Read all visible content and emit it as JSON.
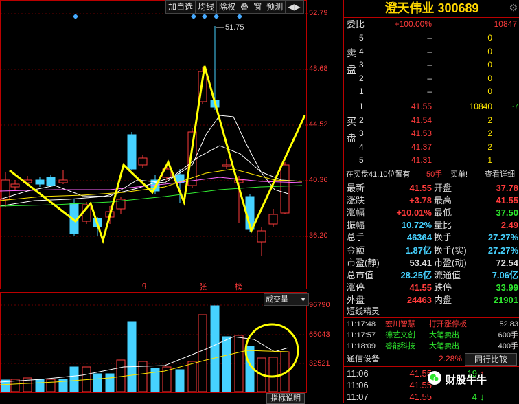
{
  "toolbar": {
    "items": [
      "加自选",
      "均线",
      "除权",
      "叠",
      "窗",
      "预测",
      "◀▶"
    ]
  },
  "chart": {
    "price_axis": [
      "52.79",
      "48.68",
      "44.52",
      "40.36",
      "36.20"
    ],
    "vol_axis": [
      "96790",
      "65043",
      "32521"
    ],
    "annotation": "51.75",
    "markers": {
      "q": "q",
      "zhang": "张",
      "bang": "榜"
    },
    "vol_dropdown": "成交量",
    "indicator_button": "指标说明",
    "colors": {
      "up": "#ff3b3b",
      "down": "#46d2ff",
      "ma_white": "#ffffff",
      "ma_yellow": "#ffe600",
      "ma_magenta": "#ff66ff",
      "ma_green": "#33ee33",
      "zigzag": "#ffff00"
    }
  },
  "quote": {
    "title": "澄天伟业 300689",
    "weibi": {
      "label": "委比",
      "pct": "+100.00%",
      "diff": "10847"
    },
    "sell_label": [
      "卖",
      "盘"
    ],
    "buy_label": [
      "买",
      "盘"
    ],
    "sell": [
      {
        "lvl": "5",
        "price": "–",
        "vol": "0"
      },
      {
        "lvl": "4",
        "price": "–",
        "vol": "0"
      },
      {
        "lvl": "3",
        "price": "–",
        "vol": "0"
      },
      {
        "lvl": "2",
        "price": "–",
        "vol": "0"
      },
      {
        "lvl": "1",
        "price": "–",
        "vol": "0"
      }
    ],
    "buy": [
      {
        "lvl": "1",
        "price": "41.55",
        "vol": "10840",
        "chg": "-7"
      },
      {
        "lvl": "2",
        "price": "41.54",
        "vol": "2",
        "chg": ""
      },
      {
        "lvl": "3",
        "price": "41.53",
        "vol": "2",
        "chg": ""
      },
      {
        "lvl": "4",
        "price": "41.37",
        "vol": "2",
        "chg": ""
      },
      {
        "lvl": "5",
        "price": "41.31",
        "vol": "1",
        "chg": ""
      }
    ],
    "bar": {
      "text": "在买盘41.10位置有",
      "hand": "50手",
      "order": "买单!",
      "detail": "查看详细"
    },
    "stats": [
      {
        "l1": "最新",
        "v1": "41.55",
        "c1": "red",
        "l2": "开盘",
        "v2": "37.78",
        "c2": "red"
      },
      {
        "l1": "涨跌",
        "v1": "+3.78",
        "c1": "red",
        "l2": "最高",
        "v2": "41.55",
        "c2": "red"
      },
      {
        "l1": "涨幅",
        "v1": "+10.01%",
        "c1": "red",
        "l2": "最低",
        "v2": "37.50",
        "c2": "grn"
      },
      {
        "l1": "振幅",
        "v1": "10.72%",
        "c1": "cyan",
        "l2": "量比",
        "v2": "2.49",
        "c2": "red"
      },
      {
        "l1": "总手",
        "v1": "46364",
        "c1": "cyan",
        "l2": "换手",
        "v2": "27.27%",
        "c2": "cyan"
      },
      {
        "l1": "金额",
        "v1": "1.87亿",
        "c1": "cyan",
        "l2": "换手(实)",
        "v2": "27.27%",
        "c2": "cyan"
      },
      {
        "l1": "市盈(静)",
        "v1": "53.41",
        "c1": "wht",
        "l2": "市盈(动)",
        "v2": "72.54",
        "c2": "wht"
      },
      {
        "l1": "总市值",
        "v1": "28.25亿",
        "c1": "cyan",
        "l2": "流通值",
        "v2": "7.06亿",
        "c2": "cyan"
      },
      {
        "l1": "涨停",
        "v1": "41.55",
        "c1": "red",
        "l2": "跌停",
        "v2": "33.99",
        "c2": "grn"
      },
      {
        "l1": "外盘",
        "v1": "24463",
        "c1": "red",
        "l2": "内盘",
        "v2": "21901",
        "c2": "grn"
      }
    ],
    "news_title": "短线精灵",
    "news": [
      {
        "time": "11:17:48",
        "name": "宏川智慧",
        "event": "打开涨停板",
        "val": "52.83",
        "nc": "red",
        "ec": "red"
      },
      {
        "time": "11:17:57",
        "name": "德艺文创",
        "event": "大笔卖出",
        "val": "600手",
        "nc": "grn",
        "ec": "grn"
      },
      {
        "time": "11:18:09",
        "name": "睿能科技",
        "event": "大笔卖出",
        "val": "400手",
        "nc": "grn",
        "ec": "grn"
      }
    ],
    "sector": {
      "name": "通信设备",
      "pct": "2.28%",
      "btn": "同行比较"
    },
    "ticks": [
      {
        "time": "11:06",
        "price": "41.55",
        "vol": "19",
        "dir": "↑"
      },
      {
        "time": "11:06",
        "price": "41.55",
        "vol": "",
        "dir": ""
      },
      {
        "time": "11:07",
        "price": "41.55",
        "vol": "4",
        "dir": "↓"
      }
    ],
    "watermark": "财股牛牛"
  }
}
